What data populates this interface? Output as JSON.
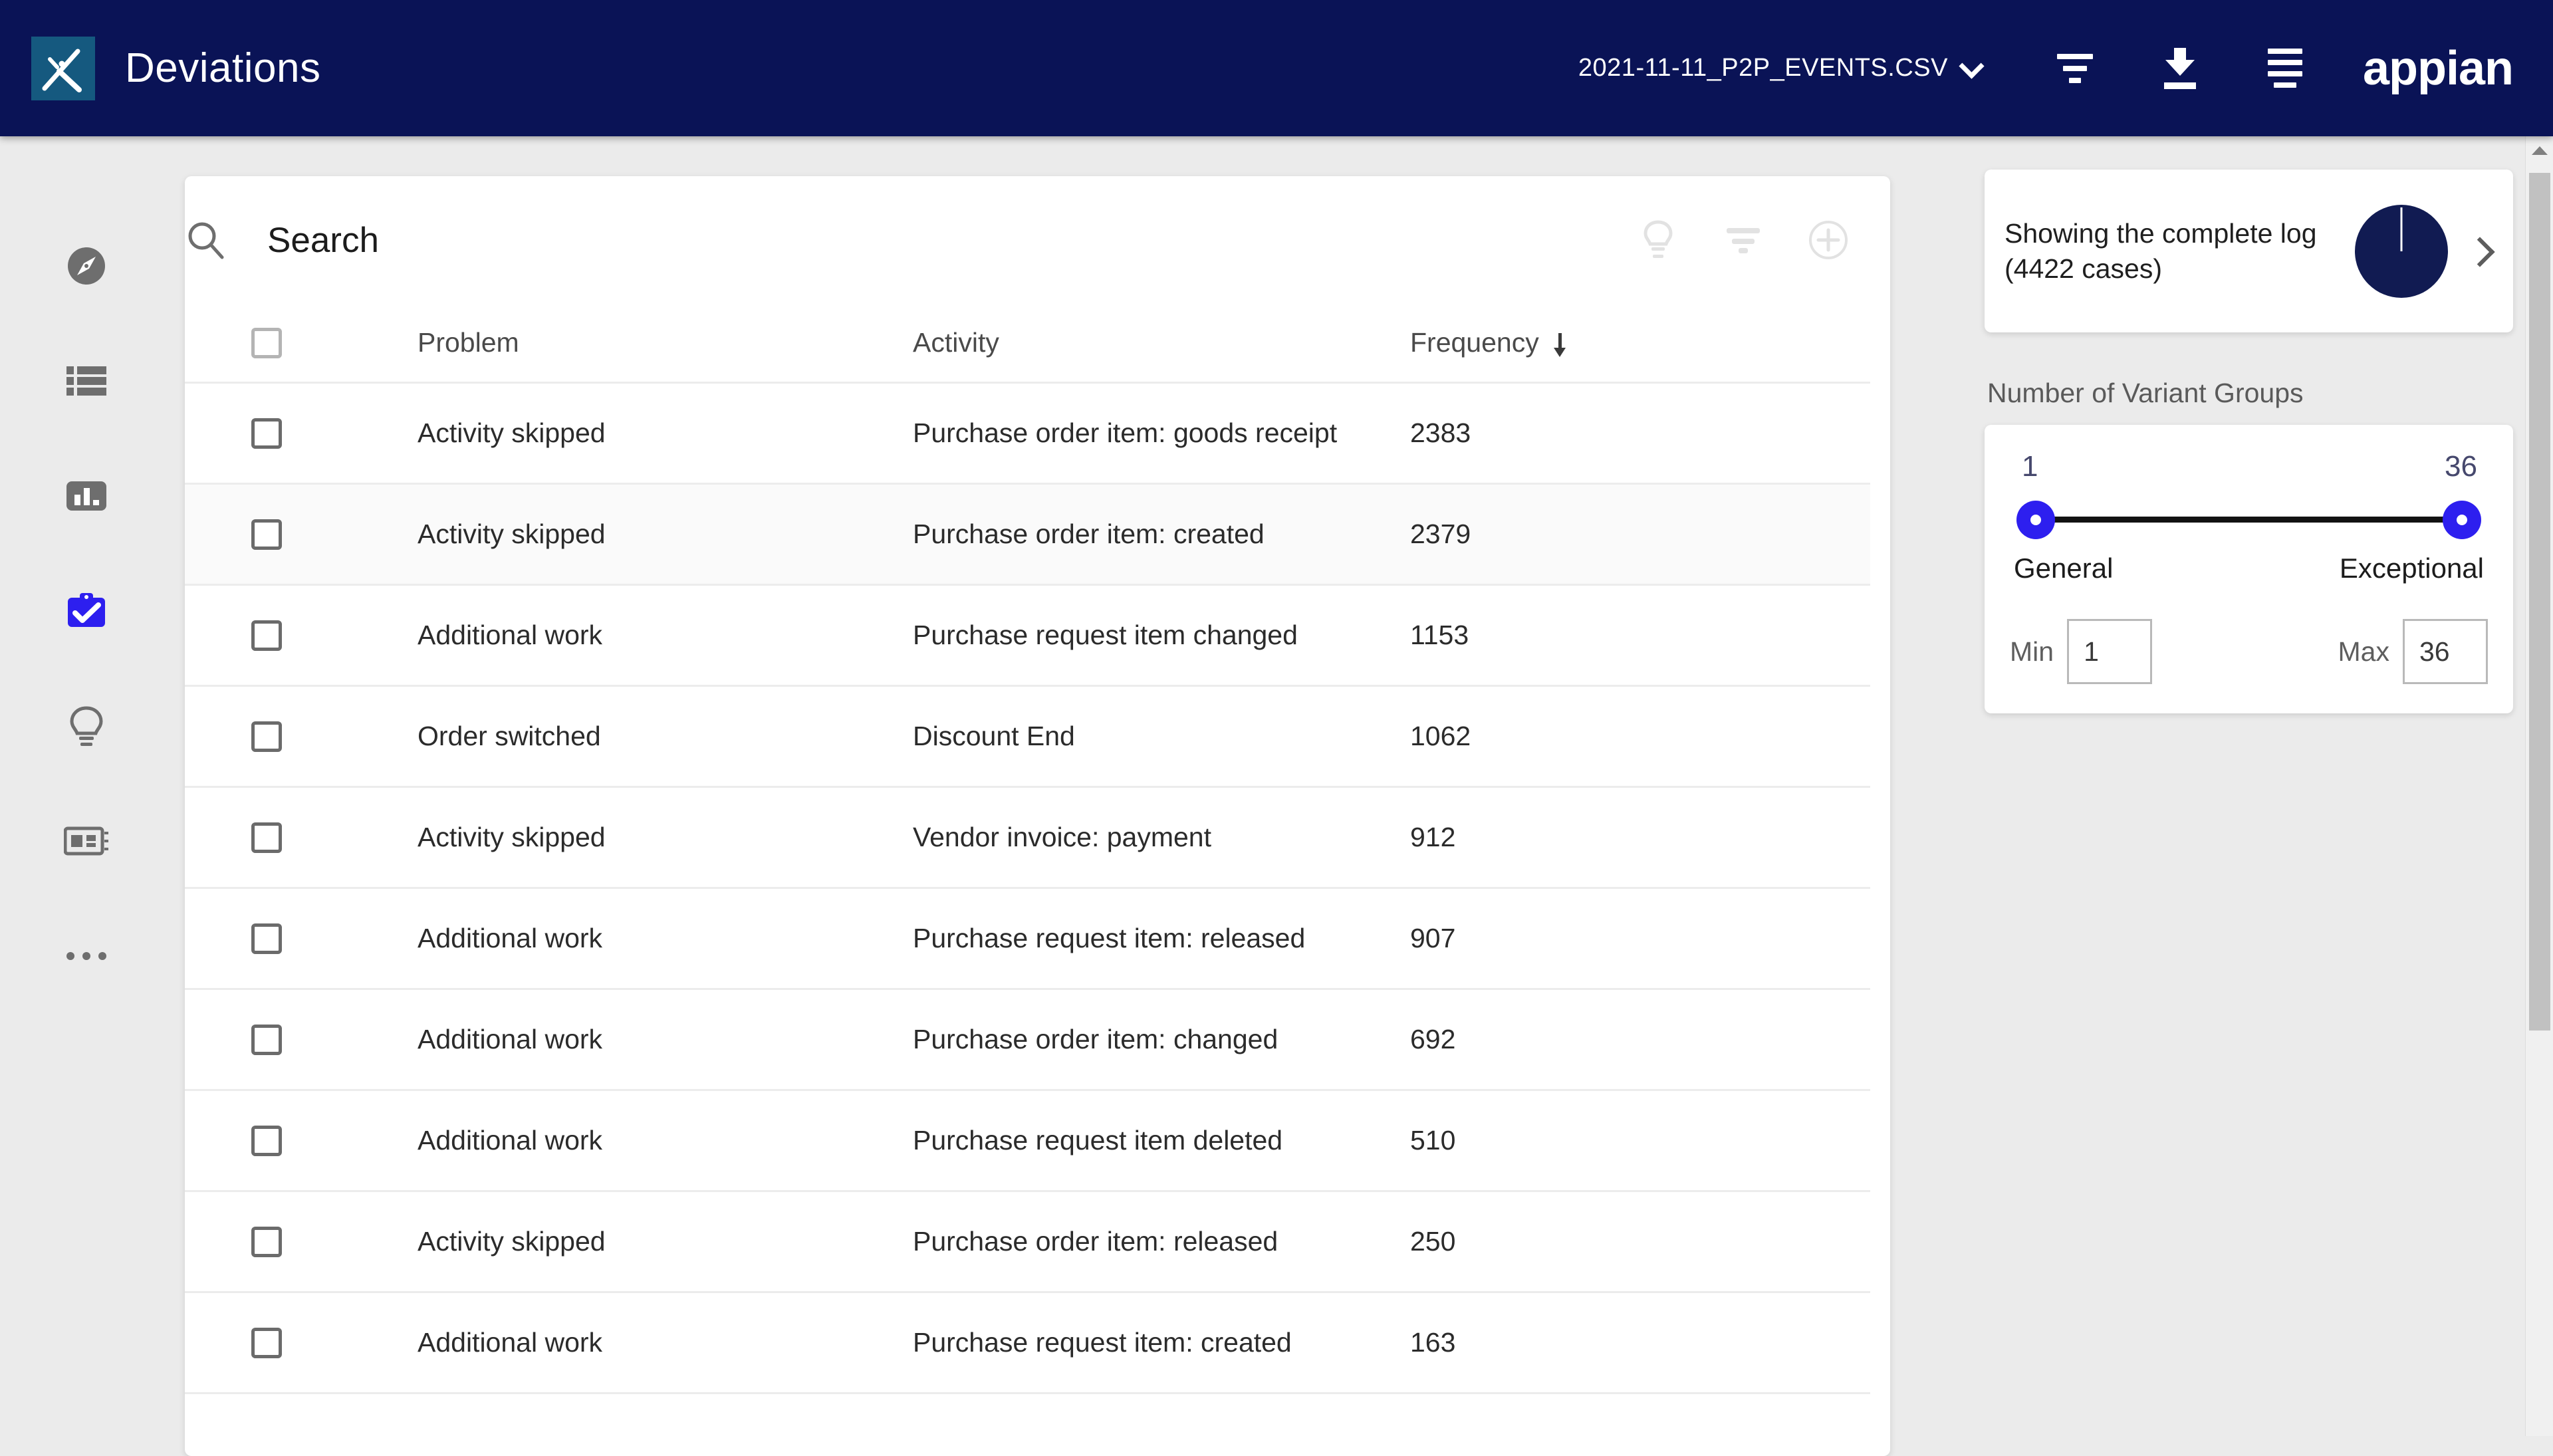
{
  "header": {
    "logo_alt": "k-logo",
    "app_title": "Deviations",
    "file_name": "2021-11-11_P2P_EVENTS.CSV",
    "icons": {
      "chevron": "chevron-down-icon",
      "filter": "filter-icon",
      "download": "download-icon",
      "menu": "menu-icon"
    },
    "brand": "appian"
  },
  "sidebar": {
    "items": [
      {
        "name": "explore",
        "icon": "compass-icon",
        "active": false
      },
      {
        "name": "process-list",
        "icon": "list-icon",
        "active": false
      },
      {
        "name": "analytics",
        "icon": "bar-chart-icon",
        "active": false
      },
      {
        "name": "deviations",
        "icon": "clipboard-check-icon",
        "active": true
      },
      {
        "name": "insights",
        "icon": "lightbulb-icon",
        "active": false
      },
      {
        "name": "dashboards",
        "icon": "dashboard-icon",
        "active": false
      },
      {
        "name": "more",
        "icon": "ellipsis-icon",
        "active": false
      }
    ]
  },
  "search": {
    "placeholder": "Search",
    "value": "",
    "icon": "search-icon",
    "actions": [
      {
        "name": "insights-action",
        "icon": "lightbulb-icon"
      },
      {
        "name": "filter-action",
        "icon": "filter-icon"
      },
      {
        "name": "add-action",
        "icon": "plus-circle-icon"
      }
    ]
  },
  "table": {
    "select_all": false,
    "columns": [
      {
        "key": "problem",
        "label": "Problem",
        "sorted": false
      },
      {
        "key": "activity",
        "label": "Activity",
        "sorted": false
      },
      {
        "key": "frequency",
        "label": "Frequency",
        "sorted": true,
        "sort_direction": "desc"
      }
    ],
    "rows": [
      {
        "problem": "Activity skipped",
        "activity": "Purchase order item: goods receipt",
        "frequency": "2383",
        "highlighted": false
      },
      {
        "problem": "Activity skipped",
        "activity": "Purchase order item: created",
        "frequency": "2379",
        "highlighted": true
      },
      {
        "problem": "Additional work",
        "activity": "Purchase request item changed",
        "frequency": "1153",
        "highlighted": false
      },
      {
        "problem": "Order switched",
        "activity": "Discount End",
        "frequency": "1062",
        "highlighted": false
      },
      {
        "problem": "Activity skipped",
        "activity": "Vendor invoice: payment",
        "frequency": "912",
        "highlighted": false
      },
      {
        "problem": "Additional work",
        "activity": "Purchase request item: released",
        "frequency": "907",
        "highlighted": false
      },
      {
        "problem": "Additional work",
        "activity": "Purchase order item: changed",
        "frequency": "692",
        "highlighted": false
      },
      {
        "problem": "Additional work",
        "activity": "Purchase request item deleted",
        "frequency": "510",
        "highlighted": false
      },
      {
        "problem": "Activity skipped",
        "activity": "Purchase order item: released",
        "frequency": "250",
        "highlighted": false
      },
      {
        "problem": "Additional work",
        "activity": "Purchase request item: created",
        "frequency": "163",
        "highlighted": false
      }
    ]
  },
  "right_panel": {
    "log_card": {
      "text": "Showing the complete log (4422 cases)",
      "pie_percent": 100,
      "pie_color": "#111b52",
      "chevron": "chevron-right-icon"
    },
    "variant_slider": {
      "title": "Number of Variant Groups",
      "low_value": "1",
      "high_value": "36",
      "low_label": "General",
      "high_label": "Exceptional",
      "min_label": "Min",
      "max_label": "Max",
      "min_value": "1",
      "max_value": "36",
      "knob_color": "#2d1fef"
    }
  },
  "colors": {
    "header_navy": "#0a1356",
    "logo_teal": "#15597f",
    "accent_blue": "#2d1fef",
    "page_bg": "#ebebeb",
    "card_bg": "#ffffff"
  }
}
